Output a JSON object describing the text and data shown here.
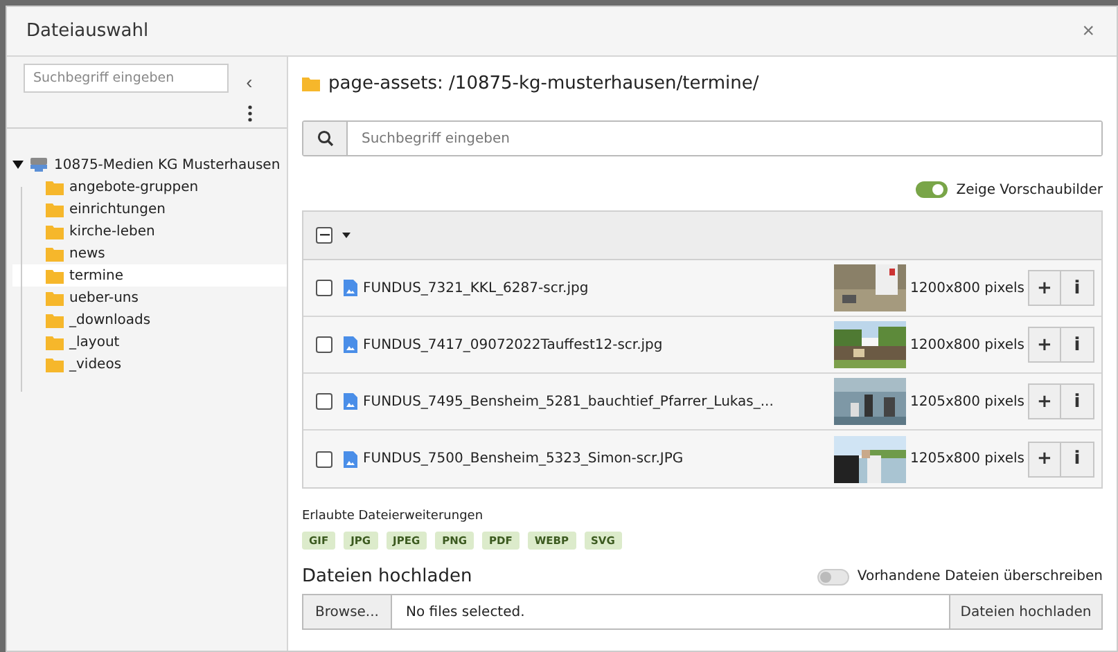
{
  "dialog": {
    "title": "Dateiauswahl",
    "close": "×"
  },
  "sidebar": {
    "search": {
      "placeholder": "Suchbegriff eingeben"
    },
    "collapse": "‹",
    "tree": [
      {
        "label": "10875-Medien KG Musterhausen",
        "kind": "storage",
        "expanded": true,
        "children": [
          {
            "label": "angebote-gruppen",
            "kind": "folder",
            "selected": false
          },
          {
            "label": "einrichtungen",
            "kind": "folder",
            "selected": false
          },
          {
            "label": "kirche-leben",
            "kind": "folder",
            "selected": false
          },
          {
            "label": "news",
            "kind": "folder",
            "selected": false
          },
          {
            "label": "termine",
            "kind": "folder",
            "selected": true
          },
          {
            "label": "ueber-uns",
            "kind": "folder",
            "selected": false
          },
          {
            "label": "_downloads",
            "kind": "folder",
            "selected": false
          },
          {
            "label": "_layout",
            "kind": "folder",
            "selected": false
          },
          {
            "label": "_videos",
            "kind": "folder",
            "selected": false
          }
        ]
      }
    ]
  },
  "main": {
    "path": "page-assets: /10875-kg-musterhausen/termine/",
    "search": {
      "placeholder": "Suchbegriff eingeben"
    },
    "thumbnails_toggle": {
      "label": "Zeige Vorschaubilder",
      "on": true
    },
    "select_all": {
      "indeterminate": true
    },
    "files": [
      {
        "name": "FUNDUS_7321_KKL_6287-scr.jpg",
        "size": "1200x800 pixels",
        "checked": false,
        "add": "+",
        "info": "i"
      },
      {
        "name": "FUNDUS_7417_09072022Tauffest12-scr.jpg",
        "size": "1200x800 pixels",
        "checked": false,
        "add": "+",
        "info": "i"
      },
      {
        "name": "FUNDUS_7495_Bensheim_5281_bauchtief_Pfarrer_Lukas_...",
        "size": "1205x800 pixels",
        "checked": false,
        "add": "+",
        "info": "i"
      },
      {
        "name": "FUNDUS_7500_Bensheim_5323_Simon-scr.JPG",
        "size": "1205x800 pixels",
        "checked": false,
        "add": "+",
        "info": "i"
      }
    ],
    "extensions_label": "Erlaubte Dateierweiterungen",
    "extensions": [
      "GIF",
      "JPG",
      "JPEG",
      "PNG",
      "PDF",
      "WEBP",
      "SVG"
    ],
    "upload": {
      "title": "Dateien hochladen",
      "overwrite": {
        "label": "Vorhandene Dateien überschreiben",
        "on": false
      },
      "browse": "Browse...",
      "value": "No files selected.",
      "submit": "Dateien hochladen"
    }
  }
}
